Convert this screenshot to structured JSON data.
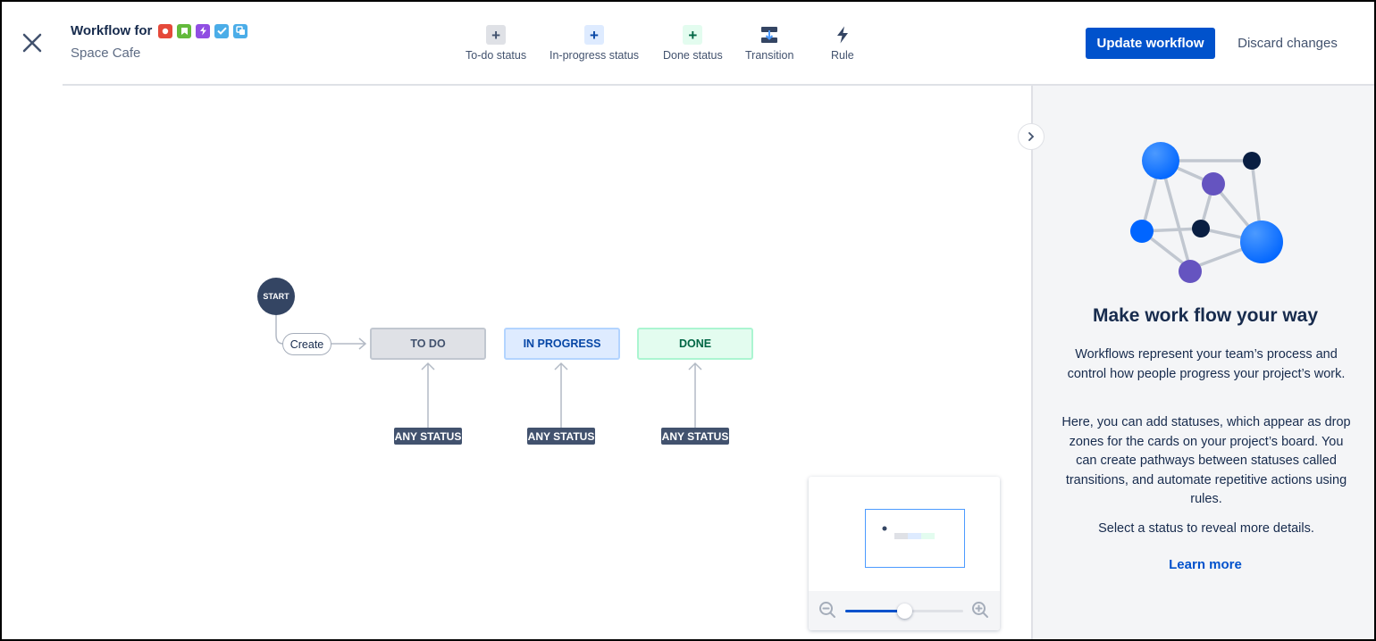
{
  "header": {
    "title": "Workflow for",
    "subtitle": "Space Cafe",
    "issue_types": [
      {
        "icon": "bug-icon",
        "color": "#e5493a"
      },
      {
        "icon": "story-icon",
        "color": "#63ba3c"
      },
      {
        "icon": "epic-icon",
        "color": "#904ee2"
      },
      {
        "icon": "task-icon",
        "color": "#4bade8"
      },
      {
        "icon": "subtask-icon",
        "color": "#4bade8"
      }
    ]
  },
  "toolbar": {
    "todo_status": "To-do status",
    "inprogress_status": "In-progress status",
    "done_status": "Done status",
    "transition": "Transition",
    "rule": "Rule"
  },
  "actions": {
    "update": "Update workflow",
    "discard": "Discard changes"
  },
  "canvas": {
    "start": "START",
    "create": "Create",
    "statuses": [
      {
        "label": "TO DO",
        "category": "todo",
        "color": "#dfe1e6"
      },
      {
        "label": "IN PROGRESS",
        "category": "in-progress",
        "color": "#deebff"
      },
      {
        "label": "DONE",
        "category": "done",
        "color": "#e3fcef"
      }
    ],
    "any_status": "ANY STATUS"
  },
  "zoom": {
    "level": 0.5
  },
  "panel": {
    "title": "Make work flow your way",
    "paragraph1": "Workflows represent your team’s process and control how people progress your project’s work.",
    "paragraph2": "Here, you can add statuses, which appear as drop zones for the cards on your project’s board. You can create pathways between statuses called transitions, and automate repetitive actions using rules.",
    "paragraph3": "Select a status to reveal more details.",
    "learn_more": "Learn more"
  },
  "colors": {
    "primary": "#0052cc",
    "text": "#172b4d",
    "subtle": "#42526e",
    "start": "#344563"
  }
}
